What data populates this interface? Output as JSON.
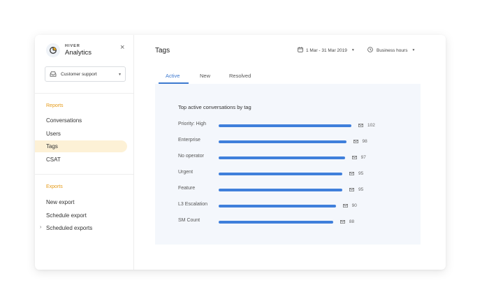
{
  "sidebar": {
    "brand_small": "HIVER",
    "brand_name": "Analytics",
    "close_symbol": "×",
    "mailbox": "Customer support",
    "reports_title": "Reports",
    "reports_items": [
      "Conversations",
      "Users",
      "Tags",
      "CSAT"
    ],
    "active_item": "Tags",
    "exports_title": "Exports",
    "exports_items": [
      "New export",
      "Schedule export",
      "Scheduled exports"
    ]
  },
  "header": {
    "title": "Tags",
    "date_range": "1 Mar - 31 Mar 2019",
    "hours": "Business hours"
  },
  "tabs": [
    "Active",
    "New",
    "Resolved"
  ],
  "active_tab": "Active",
  "colors": {
    "accent": "#3d79cf",
    "bar": "#3f7fdb",
    "section": "#e59a17",
    "active_bg": "#fdf1d6",
    "panel_bg": "#f4f7fc"
  },
  "chart_data": {
    "type": "bar",
    "title": "Top active conversations by tag",
    "categories": [
      "Priority: High",
      "Enterprise",
      "No operator",
      "Urgent",
      "Feature",
      "L3 Escalation",
      "SM Count"
    ],
    "values": [
      102,
      98,
      97,
      95,
      95,
      90,
      88
    ]
  }
}
